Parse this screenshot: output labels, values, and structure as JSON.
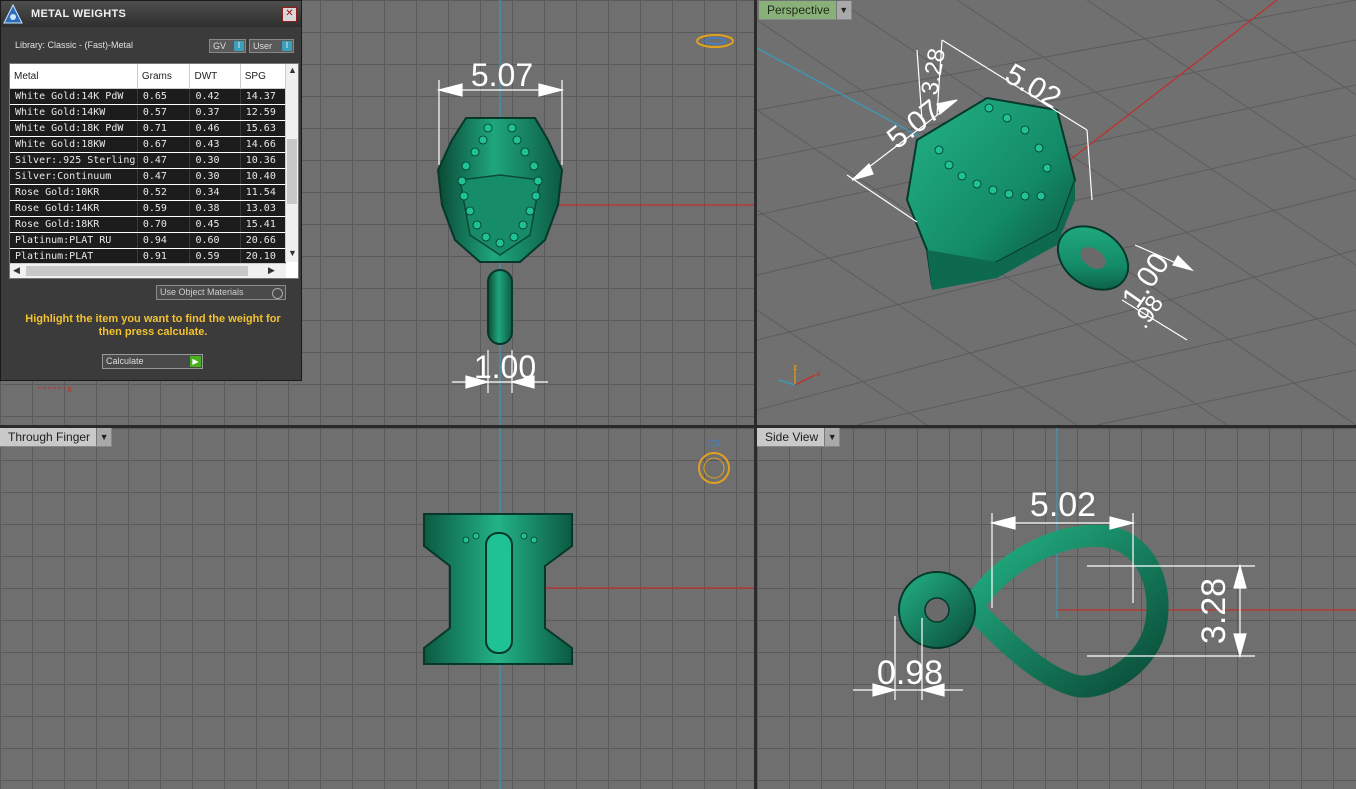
{
  "panel": {
    "title": "METAL WEIGHTS",
    "library": "Library: Classic - (Fast)-Metal",
    "gv_label": "GV",
    "user_label": "User",
    "columns": [
      "Metal",
      "Grams",
      "DWT",
      "SPG"
    ],
    "rows": [
      {
        "metal": "White Gold:14K PdW",
        "grams": "0.65",
        "dwt": "0.42",
        "spg": "14.37"
      },
      {
        "metal": "White Gold:14KW",
        "grams": "0.57",
        "dwt": "0.37",
        "spg": "12.59"
      },
      {
        "metal": "White Gold:18K PdW",
        "grams": "0.71",
        "dwt": "0.46",
        "spg": "15.63"
      },
      {
        "metal": "White Gold:18KW",
        "grams": "0.67",
        "dwt": "0.43",
        "spg": "14.66"
      },
      {
        "metal": "Silver:.925 Sterling",
        "grams": "0.47",
        "dwt": "0.30",
        "spg": "10.36"
      },
      {
        "metal": "Silver:Continuum",
        "grams": "0.47",
        "dwt": "0.30",
        "spg": "10.40"
      },
      {
        "metal": "Rose Gold:10KR",
        "grams": "0.52",
        "dwt": "0.34",
        "spg": "11.54"
      },
      {
        "metal": "Rose Gold:14KR",
        "grams": "0.59",
        "dwt": "0.38",
        "spg": "13.03"
      },
      {
        "metal": "Rose Gold:18KR",
        "grams": "0.70",
        "dwt": "0.45",
        "spg": "15.41"
      },
      {
        "metal": "Platinum:PLAT RU",
        "grams": "0.94",
        "dwt": "0.60",
        "spg": "20.66"
      },
      {
        "metal": "Platinum:PLAT",
        "grams": "0.91",
        "dwt": "0.59",
        "spg": "20.10"
      }
    ],
    "use_object_materials": "Use Object Materials",
    "hint": "Highlight the item you want to find the weight for then press calculate.",
    "calculate": "Calculate"
  },
  "viewports": {
    "top": {
      "dim_width": "5.07",
      "dim_bail": "1.00"
    },
    "perspective": {
      "label": "Perspective",
      "dim_a": "5.07",
      "dim_b": "5.02",
      "dim_c": "3.28",
      "dim_d": "1.00",
      "dim_e": ".98"
    },
    "finger": {
      "label": "Through Finger"
    },
    "side": {
      "label": "Side View",
      "dim_width": "5.02",
      "dim_height": "3.28",
      "dim_bail": "0.98"
    }
  },
  "colors": {
    "model": "#138a66",
    "axis_x": "#c0312b",
    "axis_y": "#3a9ab8",
    "dim": "#ffffff"
  }
}
